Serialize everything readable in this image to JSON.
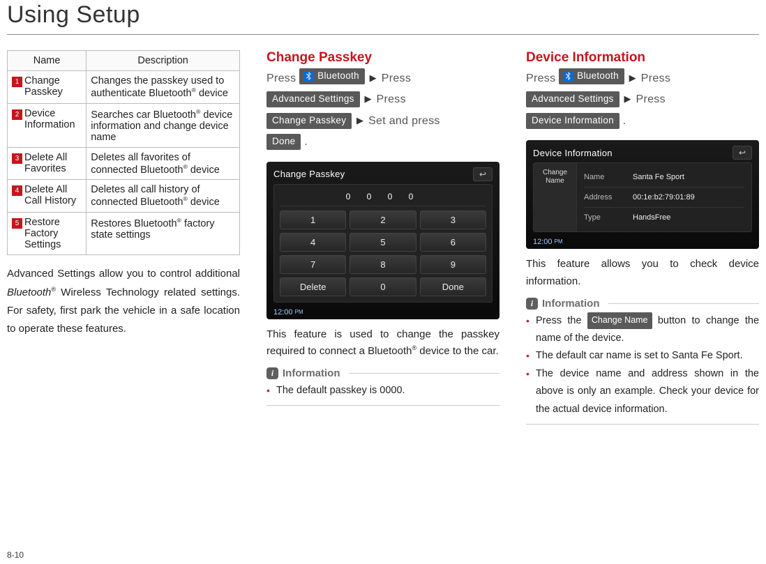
{
  "page": {
    "title": "Using Setup",
    "number": "8-10"
  },
  "table": {
    "headers": {
      "name": "Name",
      "desc": "Description"
    },
    "rows": [
      {
        "num": "1",
        "name": "Change Passkey",
        "desc_pre": "Changes the passkey used to authenticate Bluetooth",
        "desc_post": " device"
      },
      {
        "num": "2",
        "name": "Device Information",
        "desc_pre": "Searches car Bluetooth",
        "desc_post": " device information and change device name"
      },
      {
        "num": "3",
        "name": "Delete All Favorites",
        "desc_pre": "Deletes all favorites of connected Bluetooth",
        "desc_post": " device"
      },
      {
        "num": "4",
        "name": "Delete All Call History",
        "desc_pre": "Deletes all call history of connected Bluetooth",
        "desc_post": " device"
      },
      {
        "num": "5",
        "name": "Restore Factory Settings",
        "desc_pre": "Restores Bluetooth",
        "desc_post": " factory state settings"
      }
    ]
  },
  "left_para": {
    "pre": "Advanced Settings allow you to control additional ",
    "bt_word": "Bluetooth",
    "post": " Wireless Technology related settings. For safety, first park the vehicle in a safe location to operate these features."
  },
  "mid": {
    "heading": "Change Passkey",
    "press": "Press",
    "arrow": "▶",
    "chip_bluetooth": "Bluetooth",
    "chip_adv": "Advanced Settings",
    "chip_cp": "Change Passkey",
    "set_and_press": "Set and press",
    "chip_done": "Done",
    "period": ".",
    "screenshot": {
      "title": "Change Passkey",
      "display": "0 0 0 0",
      "keys": [
        "1",
        "2",
        "3",
        "4",
        "5",
        "6",
        "7",
        "8",
        "9",
        "Delete",
        "0",
        "Done"
      ],
      "clock": "12:00",
      "ampm": "PM",
      "back": "↩"
    },
    "desc_pre": "This feature is used to change the passkey required to connect a Bluetooth",
    "desc_post": " device to the car.",
    "info_label": "Information",
    "info_items": [
      "The default passkey is 0000."
    ]
  },
  "right": {
    "heading": "Device Information",
    "press": "Press",
    "arrow": "▶",
    "chip_bluetooth": "Bluetooth",
    "chip_adv": "Advanced Settings",
    "chip_di": "Device Information",
    "period": ".",
    "screenshot": {
      "title": "Device Information",
      "side": "Change Name",
      "rows": [
        {
          "k": "Name",
          "v": "Santa Fe Sport"
        },
        {
          "k": "Address",
          "v": "00:1e:b2:79:01:89"
        },
        {
          "k": "Type",
          "v": "HandsFree"
        }
      ],
      "clock": "12:00",
      "ampm": "PM",
      "back": "↩"
    },
    "desc": "This feature allows you to check device information.",
    "info_label": "Information",
    "chip_change_name": "Change Name",
    "info_items": {
      "i1_pre": "Press the ",
      "i1_post": " button to change the name of the device.",
      "i2": "The default car name is set to Santa Fe Sport.",
      "i3": "The device name and address shown in the above is only an example. Check your device for the actual device information."
    }
  }
}
